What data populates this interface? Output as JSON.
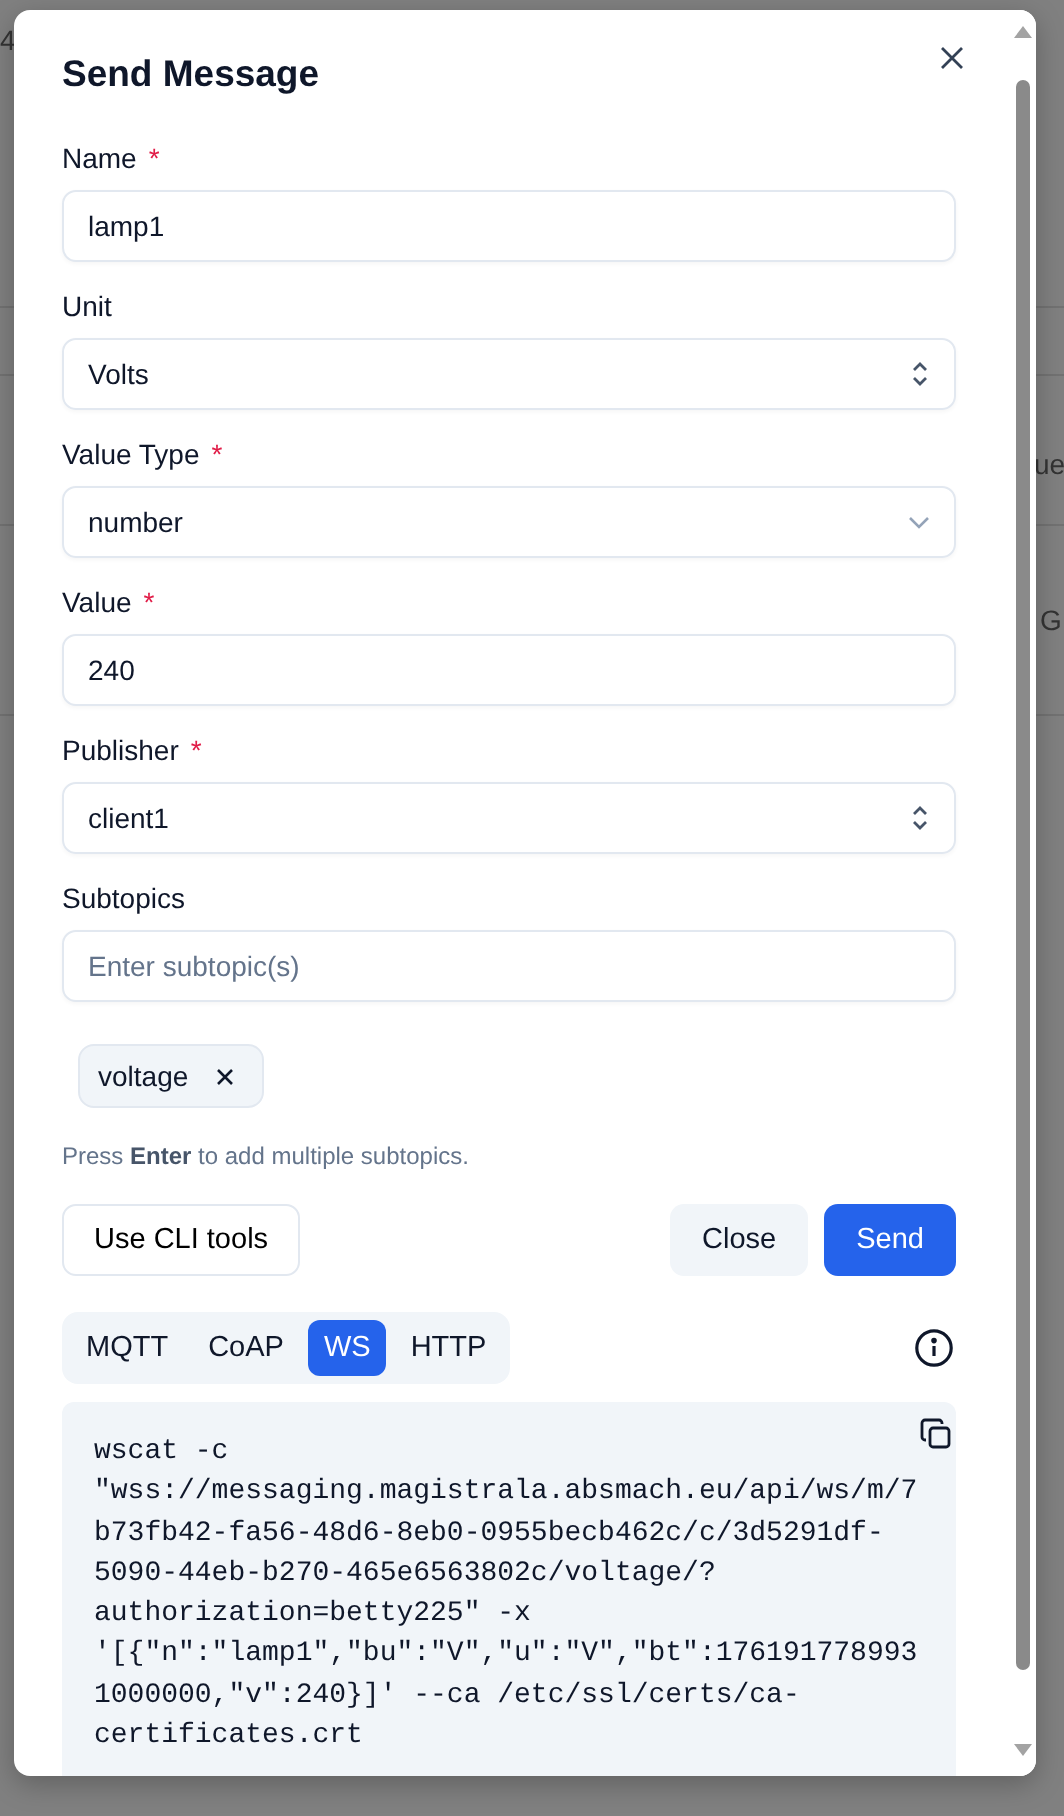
{
  "backdrop": {
    "fragments": [
      "4",
      "ue",
      "G"
    ]
  },
  "dialog": {
    "title": "Send Message",
    "fields": [
      {
        "kind": "text",
        "label": "Name",
        "required_mark": "*",
        "value": "lamp1"
      },
      {
        "kind": "select",
        "label": "Unit",
        "value": "Volts"
      },
      {
        "kind": "dropdown",
        "label": "Value Type",
        "required_mark": "*",
        "value": "number"
      },
      {
        "kind": "text",
        "label": "Value",
        "required_mark": "*",
        "value": "240"
      },
      {
        "kind": "select",
        "label": "Publisher",
        "required_mark": "*",
        "value": "client1"
      },
      {
        "kind": "text",
        "label": "Subtopics",
        "placeholder": "Enter subtopic(s)"
      }
    ],
    "chips": [
      "voltage"
    ],
    "hint": "Press **Enter** to add multiple subtopics.",
    "buttons": [
      {
        "kind": "outline",
        "label": "Use CLI tools"
      },
      {
        "kind": "secondary",
        "label": "Close"
      },
      {
        "kind": "primary",
        "label": "Send"
      }
    ],
    "protocol_tabs": [
      {
        "label": "MQTT",
        "selected": false
      },
      {
        "label": "CoAP",
        "selected": false
      },
      {
        "label": "WS",
        "selected": true
      },
      {
        "label": "HTTP",
        "selected": false
      }
    ],
    "command": "wscat -c \"wss://messaging.magistrala.absmach.eu/api/ws/m/7b73fb42-fa56-48d6-8eb0-0955becb462c/c/3d5291df-5090-44eb-b270-465e6563802c/voltage/?authorization=betty225\" -x '[{\"n\":\"lamp1\",\"bu\":\"V\",\"u\":\"V\",\"bt\":1761917789931000000,\"v\":240}]' --ca /etc/ssl/certs/ca-certificates.crt"
  }
}
